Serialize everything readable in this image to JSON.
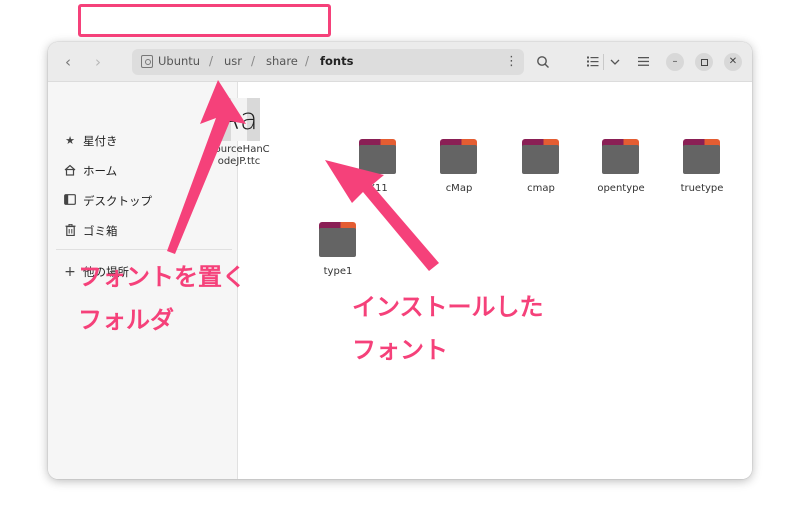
{
  "breadcrumb": {
    "segments": [
      "Ubuntu",
      "usr",
      "share",
      "fonts"
    ]
  },
  "sidebar": {
    "items": [
      {
        "label": "星付き",
        "icon": "star-icon"
      },
      {
        "label": "ホーム",
        "icon": "home-icon"
      },
      {
        "label": "デスクトップ",
        "icon": "desktop-icon"
      },
      {
        "label": "ゴミ箱",
        "icon": "trash-icon"
      },
      {
        "label": "他の場所",
        "icon": "plus-icon"
      }
    ]
  },
  "files": {
    "font_file": {
      "name": "SourceHanCodeJP.ttc",
      "preview": "Aa"
    },
    "folders": [
      "X11",
      "cMap",
      "cmap",
      "opentype",
      "truetype",
      "type1"
    ]
  },
  "annotations": {
    "folder_line1": "フォントを置く",
    "folder_line2": "フォルダ",
    "installed_line1": "インストールした",
    "installed_line2": "フォント"
  },
  "colors": {
    "annotation": "#f5417a",
    "folder_body": "#646464",
    "folder_tab_primary": "#8a1f55",
    "folder_tab_accent": "#e45d32"
  }
}
